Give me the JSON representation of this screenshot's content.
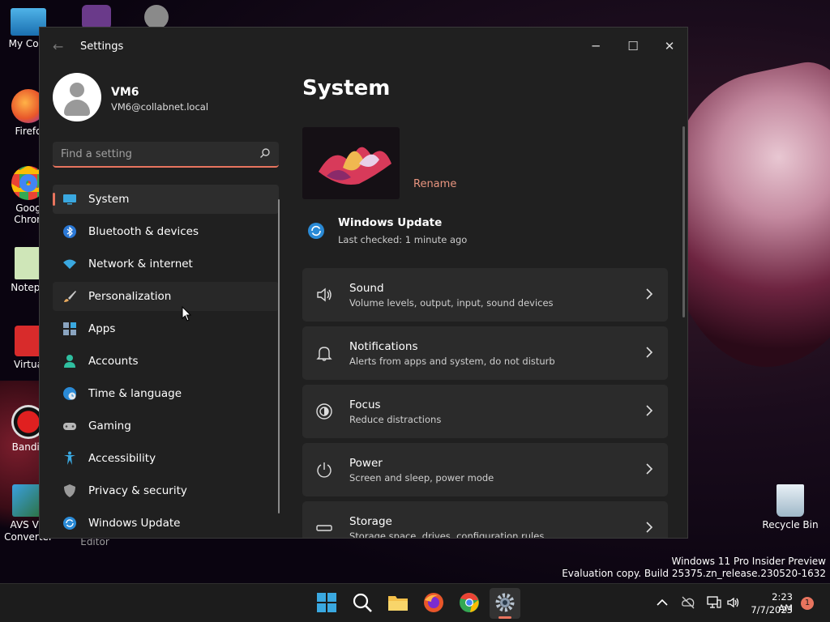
{
  "desktop": {
    "icons": [
      {
        "label": "My Com"
      },
      {
        "label": "Firefo"
      },
      {
        "label": "Goog\nChron"
      },
      {
        "label": "Notepa"
      },
      {
        "label": "Virtua"
      },
      {
        "label": "Bandic"
      },
      {
        "label": "AVS Vic\nConverter"
      },
      {
        "label": "Editor"
      },
      {
        "label": "Recycle Bin"
      }
    ]
  },
  "window": {
    "title": "Settings",
    "controls": {
      "minimize": "─",
      "maximize": "☐",
      "close": "✕"
    }
  },
  "profile": {
    "name": "VM6",
    "email": "VM6@collabnet.local"
  },
  "search": {
    "placeholder": "Find a setting"
  },
  "nav": [
    {
      "label": "System",
      "icon": "monitor-icon"
    },
    {
      "label": "Bluetooth & devices",
      "icon": "bluetooth-icon"
    },
    {
      "label": "Network & internet",
      "icon": "wifi-icon"
    },
    {
      "label": "Personalization",
      "icon": "brush-icon"
    },
    {
      "label": "Apps",
      "icon": "apps-icon"
    },
    {
      "label": "Accounts",
      "icon": "person-icon"
    },
    {
      "label": "Time & language",
      "icon": "globe-clock-icon"
    },
    {
      "label": "Gaming",
      "icon": "gamepad-icon"
    },
    {
      "label": "Accessibility",
      "icon": "accessibility-icon"
    },
    {
      "label": "Privacy & security",
      "icon": "shield-icon"
    },
    {
      "label": "Windows Update",
      "icon": "update-icon"
    }
  ],
  "main": {
    "title": "System",
    "rename": "Rename",
    "windows_update": {
      "title": "Windows Update",
      "status": "Last checked: 1 minute ago"
    },
    "cards": [
      {
        "title": "Sound",
        "subtitle": "Volume levels, output, input, sound devices",
        "icon": "speaker-icon"
      },
      {
        "title": "Notifications",
        "subtitle": "Alerts from apps and system, do not disturb",
        "icon": "bell-icon"
      },
      {
        "title": "Focus",
        "subtitle": "Reduce distractions",
        "icon": "focus-icon"
      },
      {
        "title": "Power",
        "subtitle": "Screen and sleep, power mode",
        "icon": "power-icon"
      },
      {
        "title": "Storage",
        "subtitle": "Storage space, drives, configuration rules",
        "icon": "storage-icon"
      }
    ]
  },
  "watermark": {
    "line1": "Windows 11 Pro Insider Preview",
    "line2": "Evaluation copy. Build 25375.zn_release.230520-1632"
  },
  "taskbar": {
    "time": "2:23 AM",
    "date": "7/7/2023",
    "notification_count": "1"
  },
  "colors": {
    "accent": "#e8745e",
    "window_bg": "#202020",
    "card_bg": "#2b2b2b"
  }
}
